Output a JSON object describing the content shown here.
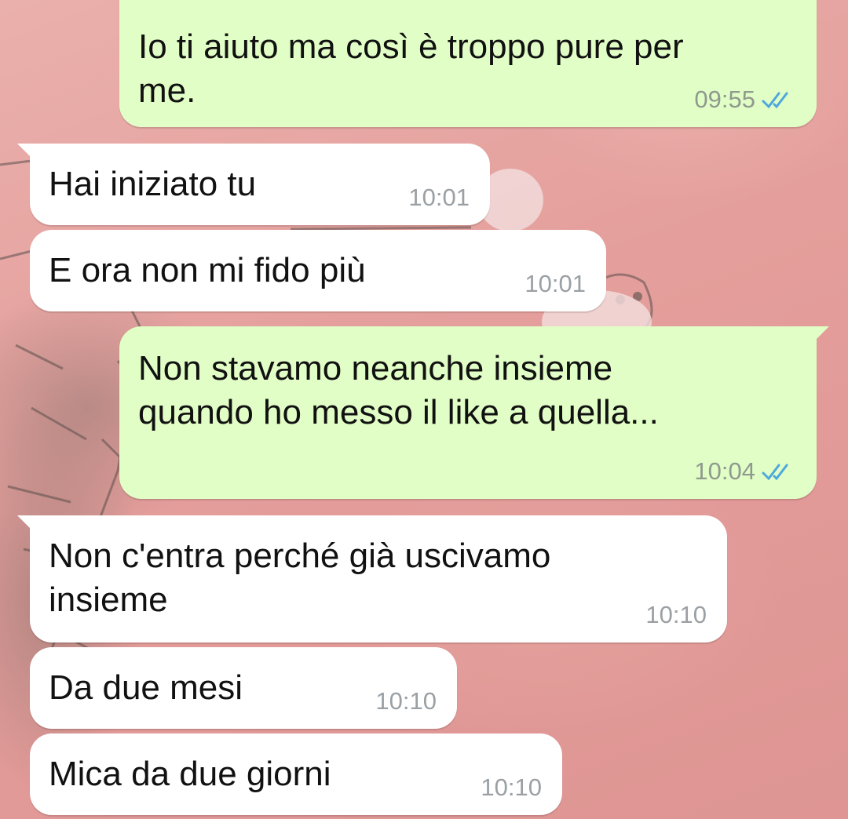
{
  "messages": [
    {
      "direction": "out",
      "text": "Io ti aiuto ma così è troppo pure per me.",
      "time": "09:55",
      "status_icon": "double-check-read-icon"
    },
    {
      "direction": "in",
      "text": "Hai iniziato tu",
      "time": "10:01"
    },
    {
      "direction": "in",
      "text": "E ora non mi fido più",
      "time": "10:01"
    },
    {
      "direction": "out",
      "text": "Non stavamo neanche insieme quando ho messo il like a quella...",
      "time": "10:04",
      "status_icon": "double-check-read-icon"
    },
    {
      "direction": "in",
      "text": "Non c'entra perché già uscivamo insieme",
      "time": "10:10"
    },
    {
      "direction": "in",
      "text": "Da due mesi",
      "time": "10:10"
    },
    {
      "direction": "in",
      "text": "Mica da due giorni",
      "time": "10:10"
    }
  ],
  "colors": {
    "outgoing_bubble": "#e1fec6",
    "incoming_bubble": "#ffffff",
    "read_ticks": "#4fa8dc",
    "wallpaper": "#e7a2a0"
  }
}
